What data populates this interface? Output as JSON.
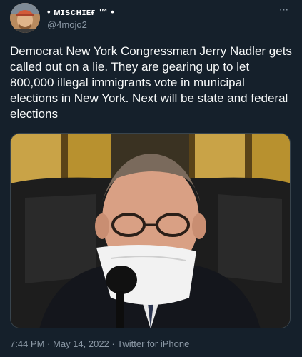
{
  "author": {
    "display_name": "• ᴍɪsᴄʜɪᴇғ ™ •",
    "handle": "@4mojo2",
    "avatar": "avatar-photo"
  },
  "more_icon": "more-horizontal-icon",
  "tweet": {
    "text": "Democrat New York Congressman Jerry Nadler gets called out on a lie. They are gearing up to let 800,000 illegal immigrants vote in municipal elections in New York. Next will be state and federal elections"
  },
  "media": {
    "type": "video-still",
    "description_icon": "media-photo"
  },
  "meta": {
    "time": "7:44 PM",
    "separator": "·",
    "date": "May 14, 2022",
    "source": "Twitter for iPhone"
  },
  "colors": {
    "background": "#15202b",
    "text": "#f7f9f9",
    "secondary": "#8b98a5",
    "border": "#38444d"
  }
}
